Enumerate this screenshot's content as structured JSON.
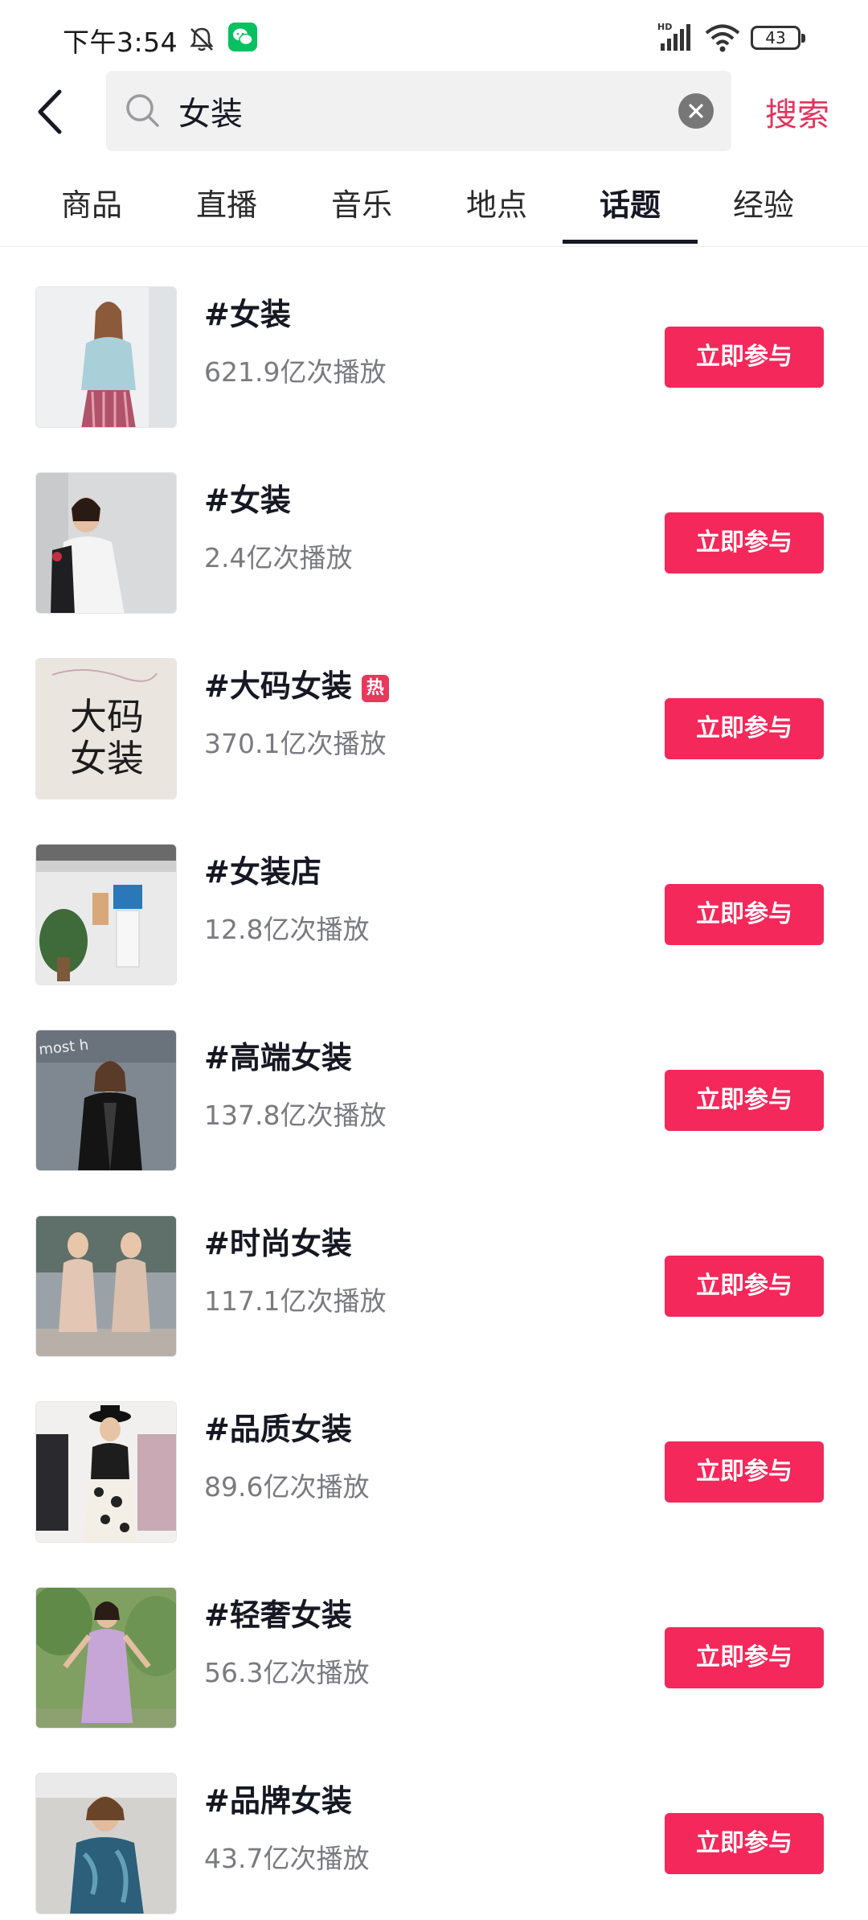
{
  "status_bar": {
    "time": "下午3:54",
    "battery": "43",
    "icons": [
      "mute-bell-icon",
      "wechat-icon",
      "hd-signal-icon",
      "wifi-icon",
      "battery-icon"
    ]
  },
  "header": {
    "back_icon": "chevron-left-icon",
    "search_value": "女装",
    "search_placeholder": "",
    "clear_icon": "clear-x-icon",
    "submit_label": "搜索"
  },
  "tabs": [
    {
      "label": "商品",
      "active": false
    },
    {
      "label": "直播",
      "active": false
    },
    {
      "label": "音乐",
      "active": false
    },
    {
      "label": "地点",
      "active": false
    },
    {
      "label": "话题",
      "active": true
    },
    {
      "label": "经验",
      "active": false
    }
  ],
  "results": [
    {
      "title": "#女装",
      "plays": "621.9亿次播放",
      "hot": false,
      "button": "立即参与"
    },
    {
      "title": "#女装",
      "plays": "2.4亿次播放",
      "hot": false,
      "button": "立即参与"
    },
    {
      "title": "#大码女装",
      "plays": "370.1亿次播放",
      "hot": true,
      "hot_label": "热",
      "thumb_text": [
        "大码",
        "女装"
      ],
      "button": "立即参与"
    },
    {
      "title": "#女装店",
      "plays": "12.8亿次播放",
      "hot": false,
      "button": "立即参与"
    },
    {
      "title": "#高端女装",
      "plays": "137.8亿次播放",
      "hot": false,
      "thumb_text": [
        "most h"
      ],
      "button": "立即参与"
    },
    {
      "title": "#时尚女装",
      "plays": "117.1亿次播放",
      "hot": false,
      "button": "立即参与"
    },
    {
      "title": "#品质女装",
      "plays": "89.6亿次播放",
      "hot": false,
      "button": "立即参与"
    },
    {
      "title": "#轻奢女装",
      "plays": "56.3亿次播放",
      "hot": false,
      "button": "立即参与"
    },
    {
      "title": "#品牌女装",
      "plays": "43.7亿次播放",
      "hot": false,
      "button": "立即参与"
    }
  ],
  "colors": {
    "accent": "#f4285a",
    "search_link": "#e3335c",
    "secondary_text": "#7a7b80",
    "hot_badge": "#e8385c"
  }
}
